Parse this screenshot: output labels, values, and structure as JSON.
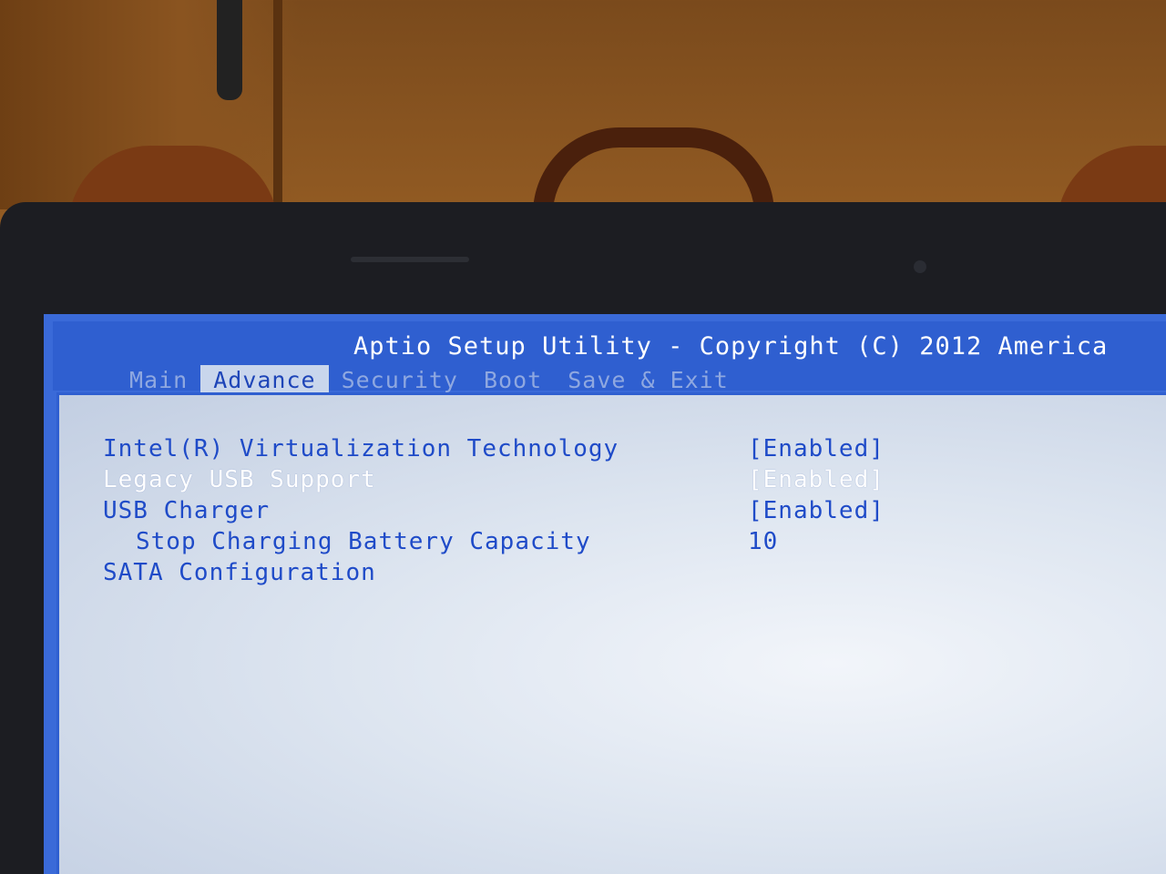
{
  "title": "Aptio Setup Utility - Copyright (C) 2012 America",
  "tabs": [
    {
      "label": "Main",
      "active": false
    },
    {
      "label": "Advance",
      "active": true
    },
    {
      "label": "Security",
      "active": false
    },
    {
      "label": "Boot",
      "active": false
    },
    {
      "label": "Save & Exit",
      "active": false
    }
  ],
  "settings": [
    {
      "label": "Intel(R) Virtualization Technology",
      "value": "[Enabled]",
      "selected": false
    },
    {
      "label": "Legacy USB Support",
      "value": "[Enabled]",
      "selected": true
    },
    {
      "label": "USB Charger",
      "value": "[Enabled]",
      "selected": false
    },
    {
      "label": "Stop Charging Battery Capacity",
      "value": "10",
      "selected": false,
      "indent": true
    },
    {
      "label": "SATA Configuration",
      "value": "",
      "selected": false
    }
  ],
  "colors": {
    "header_blue": "#2f5fd0",
    "item_text_blue": "#1f4bc8",
    "selected_text": "#ffffff",
    "active_tab_bg": "#c9d6ec"
  }
}
